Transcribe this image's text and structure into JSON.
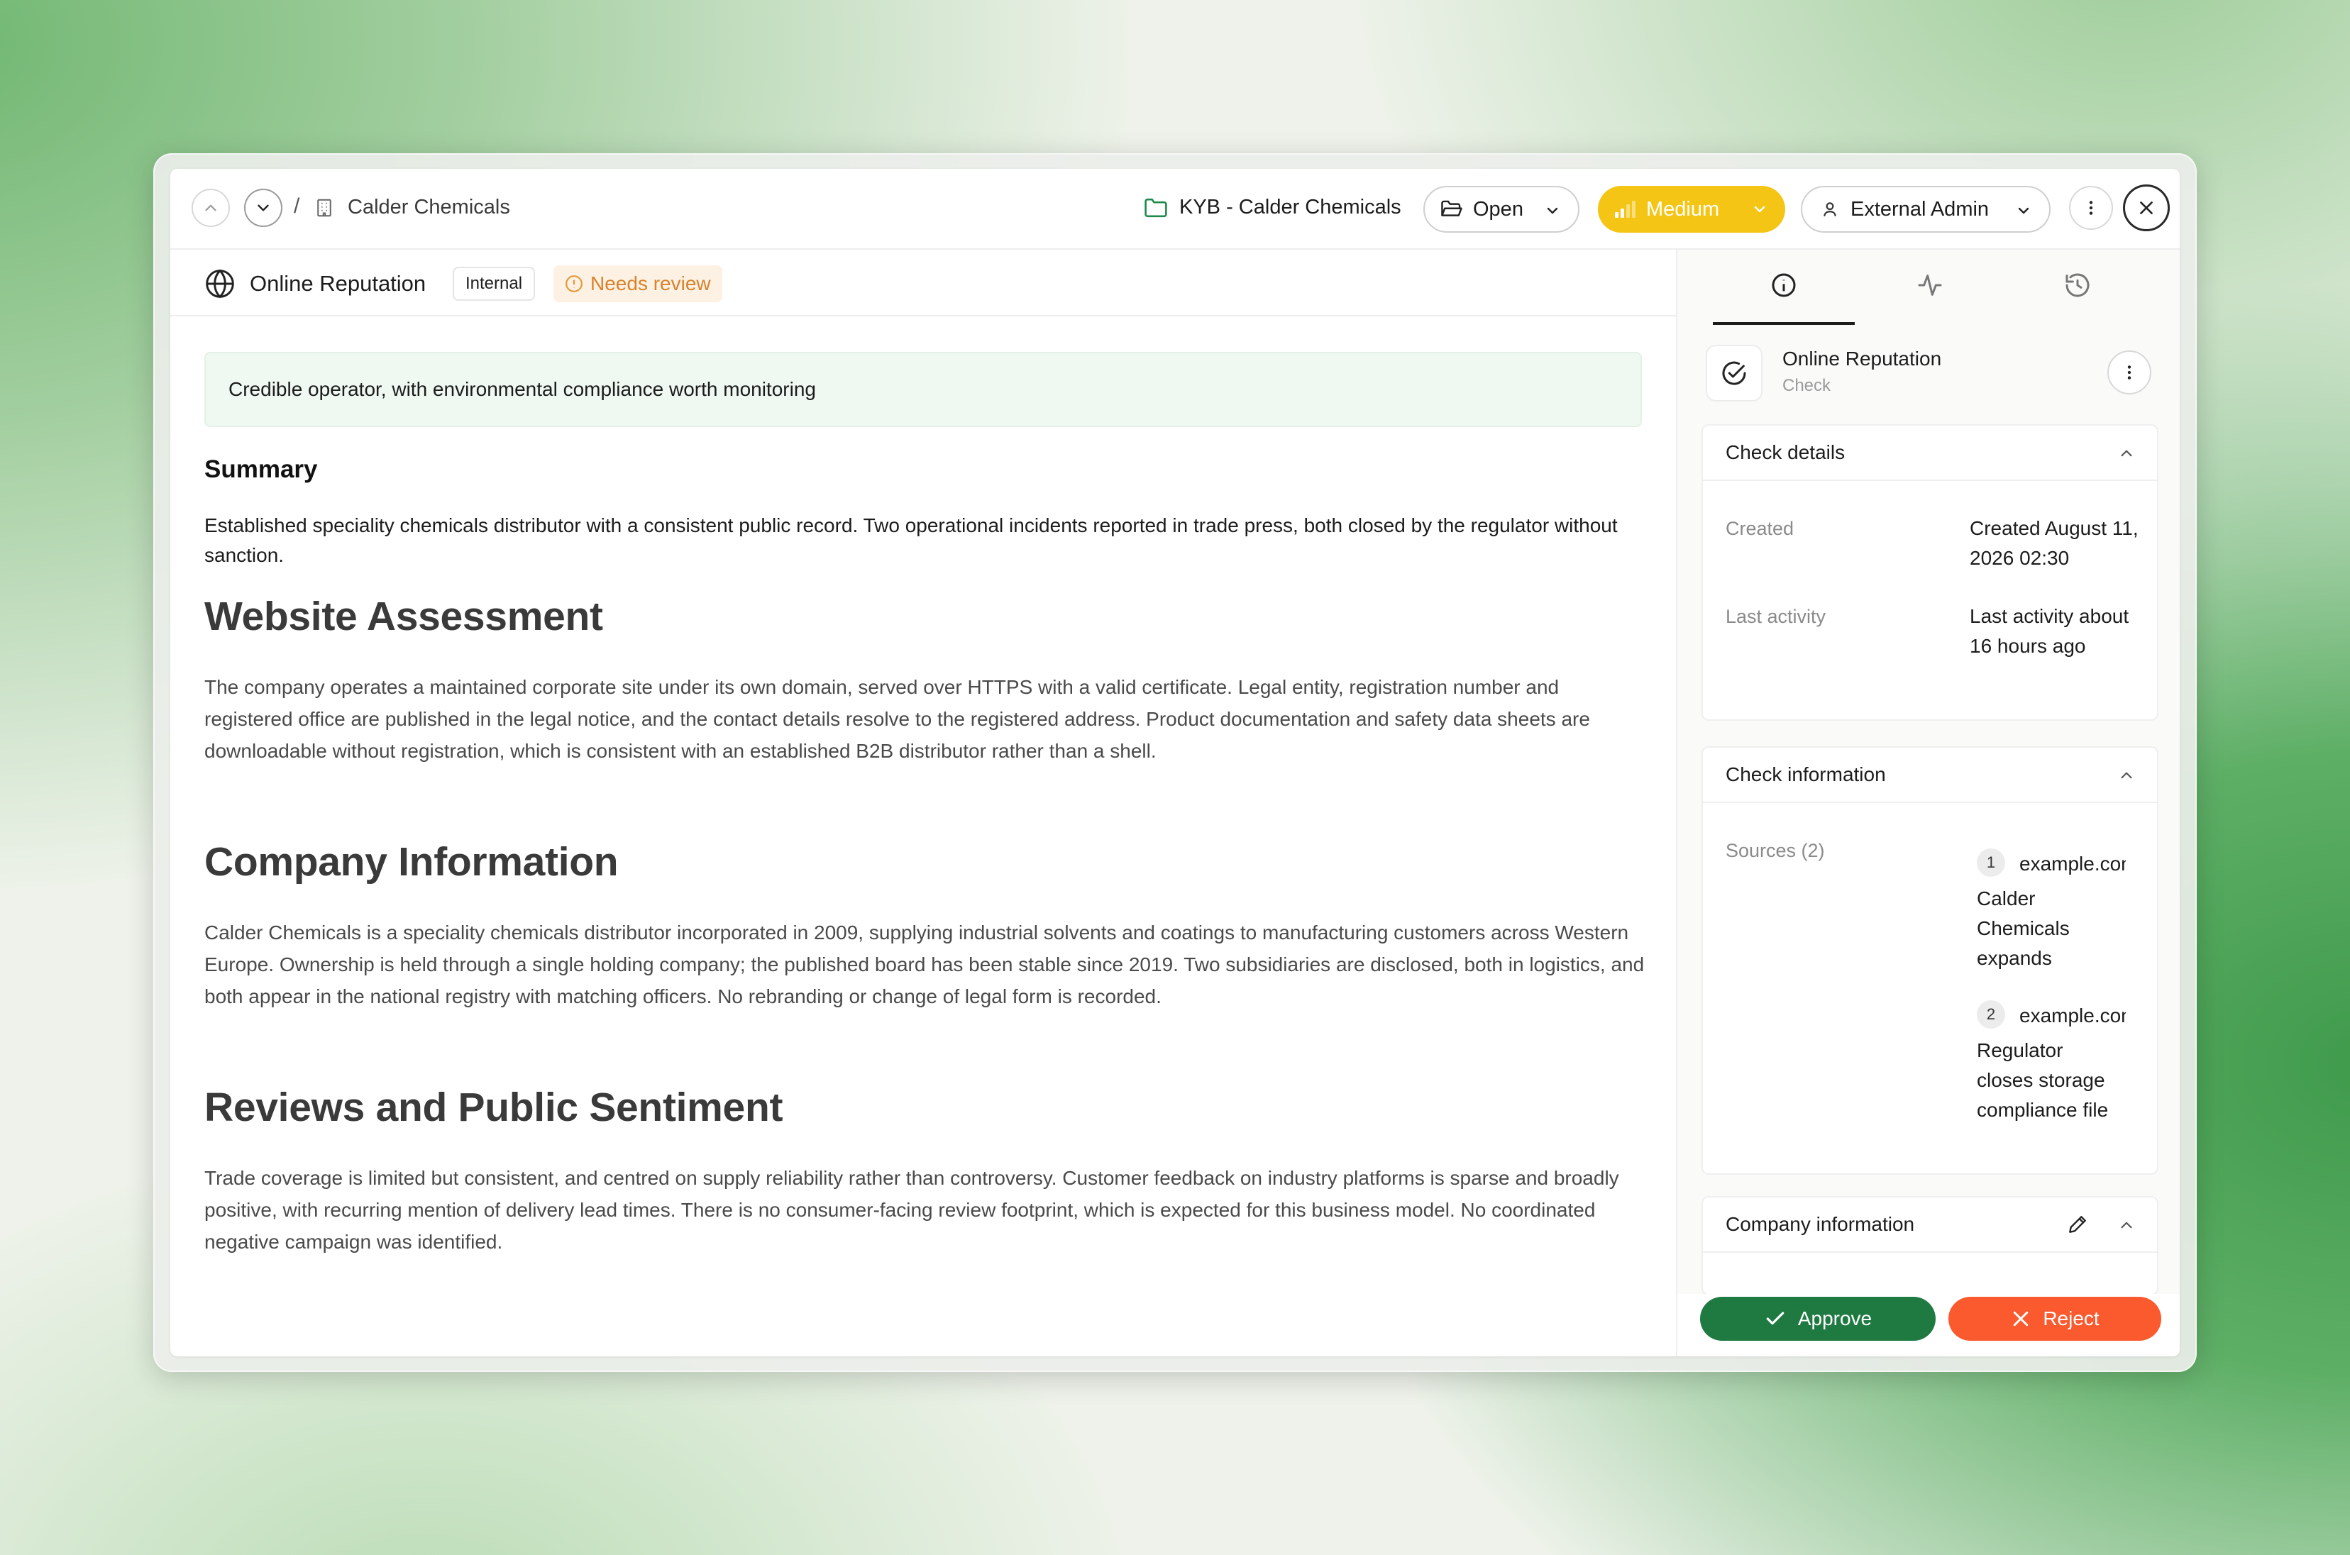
{
  "topbar": {
    "breadcrumb_sep": "/",
    "breadcrumb_title": "Calder Chemicals",
    "case_label": "KYB - Calder Chemicals",
    "status": "Open",
    "priority": "Medium",
    "assignee": "External Admin"
  },
  "check": {
    "title": "Online Reputation",
    "tag": "Internal",
    "review_status": "Needs review",
    "verdict": "Credible operator, with environmental compliance worth monitoring",
    "summary_heading": "Summary",
    "summary": "Established speciality chemicals distributor with a consistent public record. Two operational incidents reported in trade press, both closed by the regulator without sanction."
  },
  "sections": [
    {
      "heading": "Website Assessment",
      "body": "The company operates a maintained corporate site under its own domain, served over HTTPS with a valid certificate. Legal entity, registration number and registered office are published in the legal notice, and the contact details resolve to the registered address. Product documentation and safety data sheets are downloadable without registration, which is consistent with an established B2B distributor rather than a shell."
    },
    {
      "heading": "Company Information",
      "body": "Calder Chemicals is a speciality chemicals distributor incorporated in 2009, supplying industrial solvents and coatings to manufacturing customers across Western Europe. Ownership is held through a single holding company; the published board has been stable since 2019. Two subsidiaries are disclosed, both in logistics, and both appear in the national registry with matching officers. No rebranding or change of legal form is recorded."
    },
    {
      "heading": "Reviews and Public Sentiment",
      "body": "Trade coverage is limited but consistent, and centred on supply reliability rather than controversy. Customer feedback on industry platforms is sparse and broadly positive, with recurring mention of delivery lead times. There is no consumer-facing review footprint, which is expected for this business model. No coordinated negative campaign was identified."
    }
  ],
  "side": {
    "head_title": "Online Reputation",
    "head_sub": "Check",
    "details": {
      "title": "Check details",
      "created_key": "Created",
      "created_val": "Created August 11, 2026 02:30",
      "activity_key": "Last activity",
      "activity_val": "Last activity about 16 hours ago"
    },
    "information": {
      "title": "Check information",
      "sources_key": "Sources (2)",
      "sources": [
        {
          "num": "1",
          "domain": "example.com",
          "title": "Calder Chemicals expands Benelux distribution"
        },
        {
          "num": "2",
          "domain": "example.com",
          "title": "Regulator closes storage compliance file at Calder site"
        }
      ]
    },
    "company": {
      "title": "Company information"
    },
    "approve": "Approve",
    "reject": "Reject"
  }
}
